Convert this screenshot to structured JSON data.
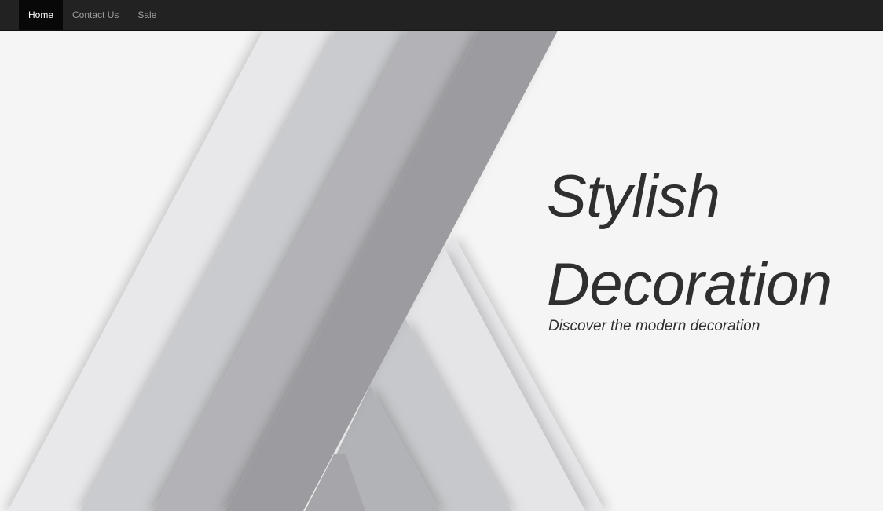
{
  "nav": {
    "items": [
      {
        "label": "Home",
        "active": true
      },
      {
        "label": "Contact Us",
        "active": false
      },
      {
        "label": "Sale",
        "active": false
      }
    ]
  },
  "hero": {
    "title_line1": "Stylish",
    "title_line2": "Decoration",
    "subtitle": "Discover the modern decoration"
  },
  "colors": {
    "navbar_bg": "#222222",
    "nav_active_bg": "#080808",
    "page_bg": "#f5f5f5",
    "text": "#2f2f2f"
  }
}
